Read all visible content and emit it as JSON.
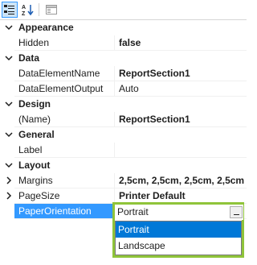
{
  "toolbar": {
    "buttons": [
      {
        "name": "categorized-icon",
        "active": true
      },
      {
        "name": "sort-alphabetical-icon",
        "active": false
      },
      {
        "name": "property-pages-icon",
        "active": false
      }
    ]
  },
  "grid": {
    "categories": [
      {
        "title": "Appearance",
        "rows": [
          {
            "name": "Hidden",
            "value": "false",
            "bold": true
          }
        ]
      },
      {
        "title": "Data",
        "rows": [
          {
            "name": "DataElementName",
            "value": "ReportSection1",
            "bold": true
          },
          {
            "name": "DataElementOutput",
            "value": "Auto",
            "bold": false
          }
        ]
      },
      {
        "title": "Design",
        "rows": [
          {
            "name": "(Name)",
            "value": "ReportSection1",
            "bold": true
          }
        ]
      },
      {
        "title": "General",
        "rows": [
          {
            "name": "Label",
            "value": "",
            "bold": false
          }
        ]
      },
      {
        "title": "Layout",
        "rows": [
          {
            "name": "Margins",
            "value": "2,5cm, 2,5cm, 2,5cm, 2,5cm",
            "bold": true,
            "expandable": true
          },
          {
            "name": "PageSize",
            "value": "Printer Default",
            "bold": true,
            "expandable": true
          },
          {
            "name": "PaperOrientation",
            "value": "Portrait",
            "selected": true
          }
        ]
      }
    ]
  },
  "dropdown": {
    "current": "Portrait",
    "options": [
      "Portrait",
      "Landscape"
    ],
    "selected_index": 0
  },
  "colors": {
    "selection": "#3399ff",
    "dropdown_selection": "#0078d7",
    "highlight_border": "#8fc43a"
  }
}
